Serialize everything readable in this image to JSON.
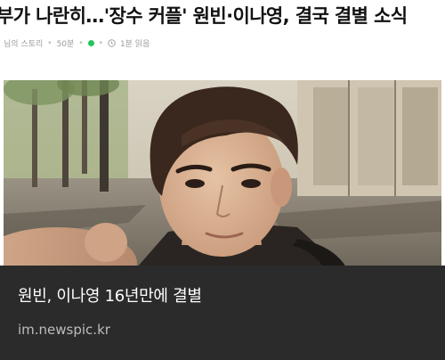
{
  "article": {
    "headline": "부가 나란히…'장수 커플' 원빈·이나영, 결국 결별 소식",
    "meta": {
      "blog_name": "님의 스토리",
      "time_ago": "50분",
      "read_time": "1분 읽음"
    }
  },
  "photo": {
    "icon": "person-photo"
  },
  "link_card": {
    "title": "원빈, 이나영 16년만에 결별",
    "source": "im.newspic.kr"
  },
  "colors": {
    "caption_bg": "#2b2b2b",
    "caption_title": "#ffffff",
    "caption_source": "#bdbdbd",
    "meta_text": "#9a9a9a",
    "status_dot": "#21c65a"
  }
}
